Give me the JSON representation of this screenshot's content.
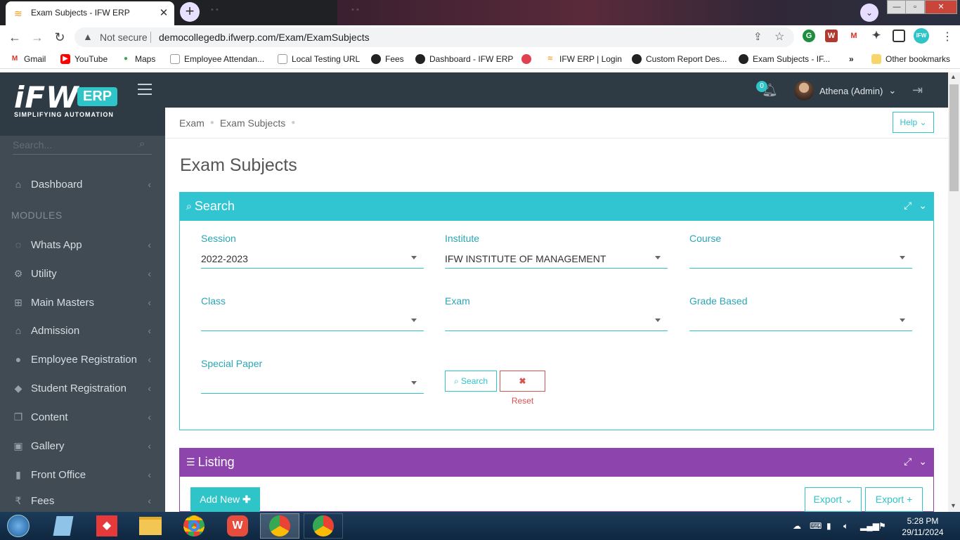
{
  "browser": {
    "active_tab_title": "Exam Subjects - IFW ERP",
    "security": "Not secure",
    "url": "democollegedb.ifwerp.com/Exam/ExamSubjects",
    "bookmarks": [
      "Gmail",
      "YouTube",
      "Maps",
      "Employee Attendan...",
      "Local Testing URL",
      "Fees",
      "Dashboard - IFW ERP",
      "IFW ERP | Login",
      "Custom Report Des...",
      "Exam Subjects - IF..."
    ],
    "other_bookmarks": "Other bookmarks",
    "bookmarks_overflow": "»"
  },
  "app": {
    "logo_text": "iFW",
    "logo_badge": "ERP",
    "tagline": "SIMPLIFYING AUTOMATION",
    "sidebar_search_placeholder": "Search...",
    "dashboard_label": "Dashboard",
    "modules_label": "MODULES",
    "menu": [
      "Whats App",
      "Utility",
      "Main Masters",
      "Admission",
      "Employee Registration",
      "Student Registration",
      "Content",
      "Gallery",
      "Front Office",
      "Fees"
    ],
    "notification_count": "0",
    "user_name": "Athena (Admin)"
  },
  "breadcrumb": {
    "items": [
      "Exam",
      "Exam Subjects"
    ]
  },
  "help_label": "Help",
  "page_title": "Exam Subjects",
  "search_panel": {
    "title": "Search",
    "fields": {
      "session": {
        "label": "Session",
        "value": "2022-2023"
      },
      "institute": {
        "label": "Institute",
        "value": "IFW INSTITUTE OF MANAGEMENT"
      },
      "course": {
        "label": "Course",
        "value": ""
      },
      "class": {
        "label": "Class",
        "value": ""
      },
      "exam": {
        "label": "Exam",
        "value": ""
      },
      "grade_based": {
        "label": "Grade Based",
        "value": ""
      },
      "special_paper": {
        "label": "Special Paper",
        "value": ""
      }
    },
    "search_button": "Search",
    "reset_button": "Reset"
  },
  "listing_panel": {
    "title": "Listing",
    "add_new": "Add New",
    "export_dropdown": "Export",
    "export_plus": "Export +"
  },
  "taskbar": {
    "time": "5:28 PM",
    "date": "29/11/2024"
  }
}
